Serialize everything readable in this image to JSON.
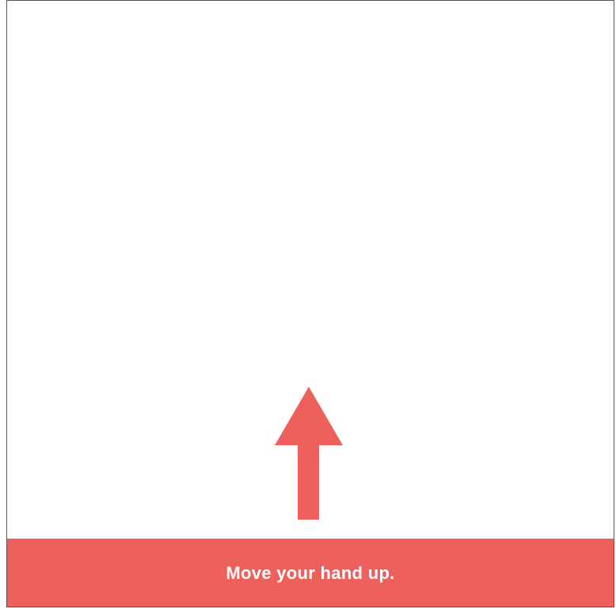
{
  "instruction": {
    "text": "Move your hand up.",
    "background_color": "#EE605C",
    "text_color": "#FFFFFF"
  },
  "arrow": {
    "icon": "arrow-up-icon",
    "direction": "up",
    "color": "#EE605C"
  }
}
